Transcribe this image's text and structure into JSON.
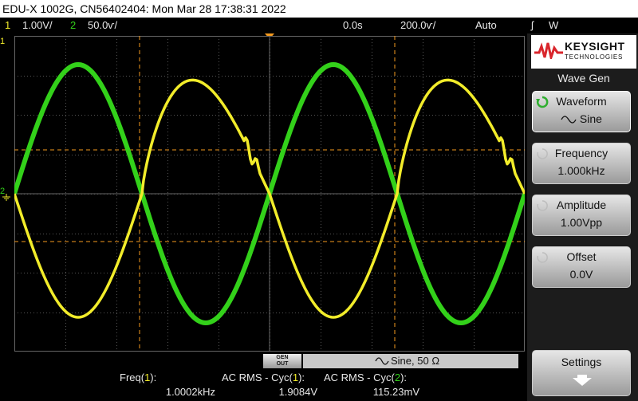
{
  "title": "EDU-X 1002G, CN56402404: Mon Mar 28 17:38:31 2022",
  "status": {
    "ch1_num": "1",
    "ch1_scale": "1.00V/",
    "ch2_num": "2",
    "ch2_scale": "50.0ѵ/",
    "time_delay": "0.0s",
    "time_scale": "200.0ѵ/",
    "trigger_mode": "Auto",
    "trigger_slope": "ʃ",
    "trigger_source": "W"
  },
  "waveform": {
    "ch1_color": "#f2ec2a",
    "ch2_color": "#33d11a",
    "ch1_marker": "1",
    "ch2_marker": "2"
  },
  "sidebar": {
    "brand": "KEYSIGHT",
    "brand_sub": "TECHNOLOGIES",
    "menu_title": "Wave Gen",
    "softkeys": [
      {
        "label": "Waveform",
        "value": "Sine"
      },
      {
        "label": "Frequency",
        "value": "1.000kHz"
      },
      {
        "label": "Amplitude",
        "value": "1.00Vpp"
      },
      {
        "label": "Offset",
        "value": "0.0V"
      }
    ],
    "settings_label": "Settings"
  },
  "gen": {
    "button_line1": "GEN",
    "button_line2": "OUT",
    "info": "Sine, 50 Ω"
  },
  "measurements": [
    {
      "name_prefix": "Freq(",
      "channel": "1",
      "name_suffix": "):",
      "value": "1.0002kHz"
    },
    {
      "name_prefix": "AC RMS - Cyc(",
      "channel": "1",
      "name_suffix": "):",
      "value": "1.9084V"
    },
    {
      "name_prefix": "AC RMS - Cyc(",
      "channel": "2",
      "name_suffix": "):",
      "value": "115.23mV"
    }
  ]
}
